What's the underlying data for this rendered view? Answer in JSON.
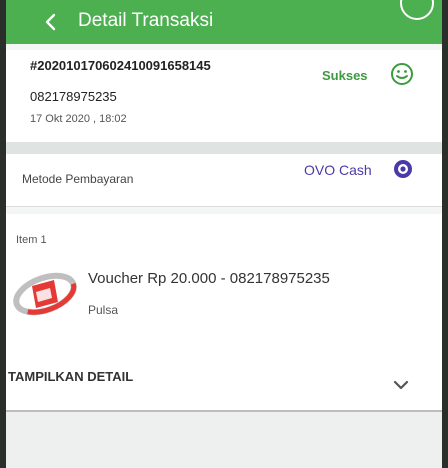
{
  "header": {
    "title": "Detail Transaksi",
    "back_icon": "chevron-left-icon",
    "color": "#4caf50"
  },
  "transaction": {
    "id": "#2020101706024100916581​45",
    "phone": "082178975235",
    "datetime": "17 Okt 2020 , 18:02",
    "status": "Sukses",
    "status_icon": "smile-icon",
    "status_color": "#3c9a3f"
  },
  "payment": {
    "label": "Metode Pembayaran",
    "value": "OVO Cash",
    "icon": "ovo-icon",
    "color": "#4a3aa8"
  },
  "item": {
    "label": "Item 1",
    "title": "Voucher Rp 20.000 - 082178975235",
    "category": "Pulsa",
    "logo": "telkomsel-logo"
  },
  "detail_toggle": {
    "label": "TAMPILKAN DETAIL",
    "icon": "chevron-down-icon"
  }
}
